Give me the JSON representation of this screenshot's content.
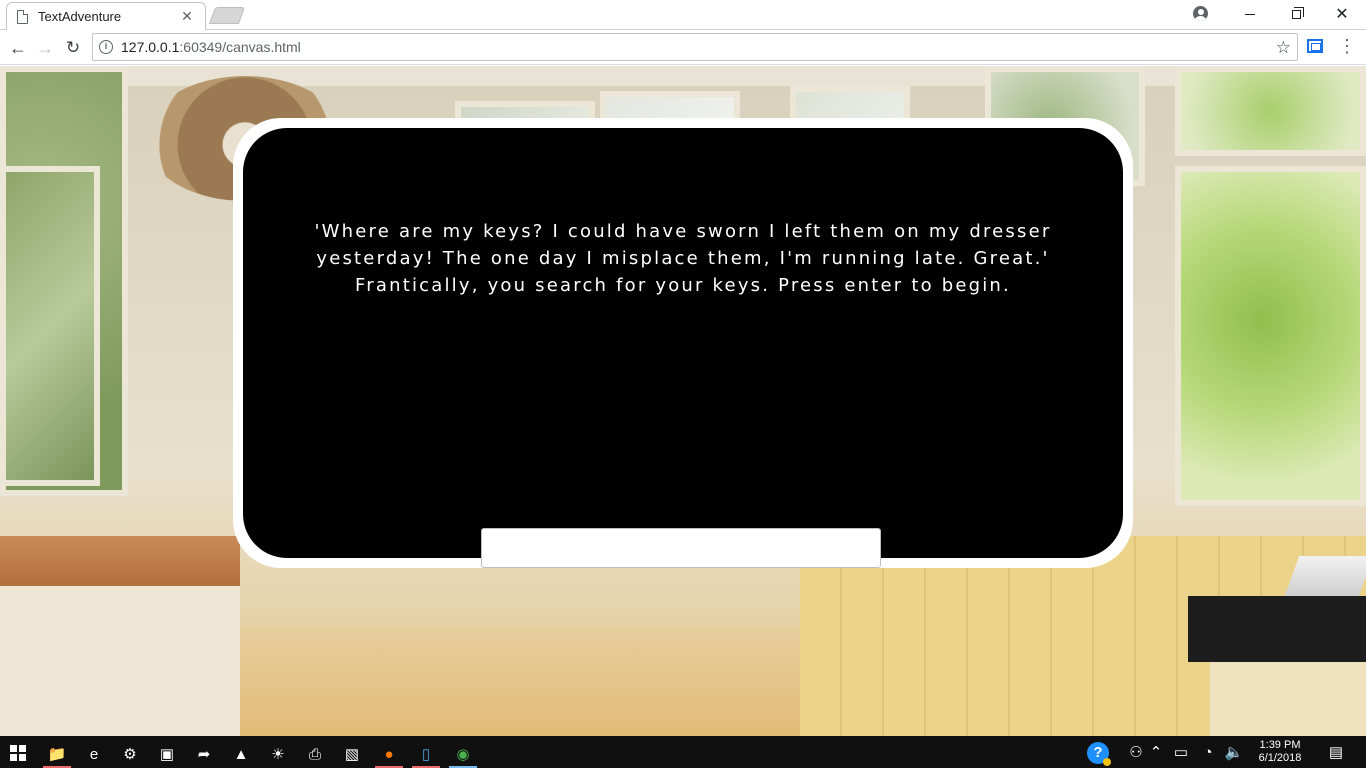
{
  "browser": {
    "tab_title": "TextAdventure",
    "url_host": "127.0.0.1",
    "url_rest": ":60349/canvas.html"
  },
  "game": {
    "story_text": "'Where are my keys? I could have sworn I left them on my dresser yesterday! The one day I misplace them, I'm running late. Great.' Frantically, you search for your keys. Press enter to begin.",
    "input_value": ""
  },
  "taskbar": {
    "pinned": [
      "file-explorer",
      "internet-explorer",
      "control-panel",
      "photo-viewer",
      "shortcut",
      "google-drive",
      "brightness",
      "printer",
      "photos",
      "firefox",
      "app-frame",
      "chrome"
    ],
    "time": "1:39 PM",
    "date": "6/1/2018"
  }
}
